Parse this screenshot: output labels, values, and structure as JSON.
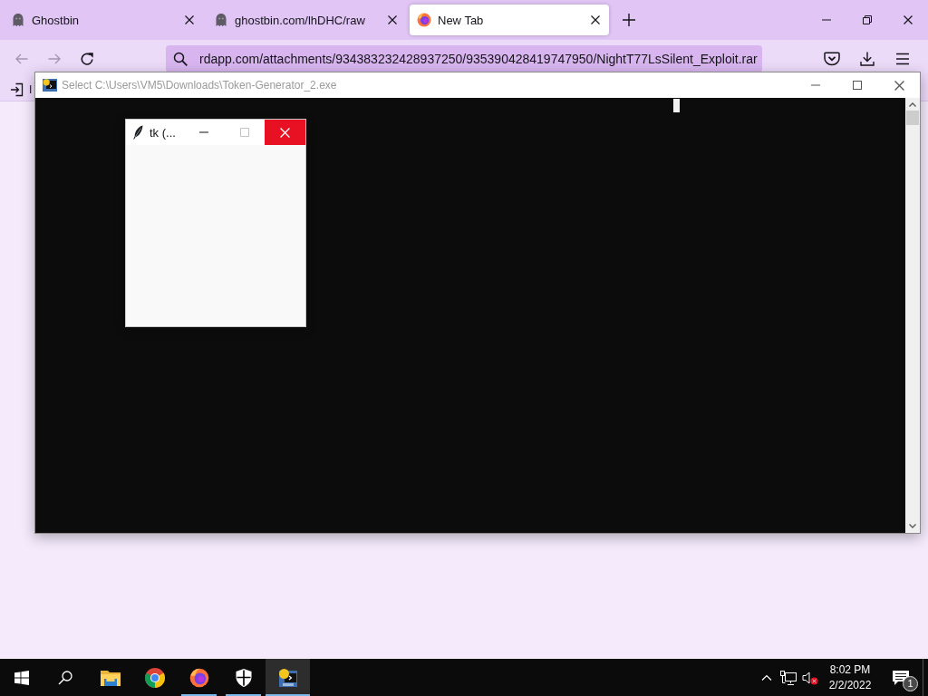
{
  "browser": {
    "tabs": [
      {
        "kind": "ghost",
        "title": "Ghostbin",
        "selected": false
      },
      {
        "kind": "ghost",
        "title": "ghostbin.com/lhDHC/raw",
        "selected": false
      },
      {
        "kind": "firefox",
        "title": "New Tab",
        "selected": true
      }
    ],
    "navigation": {
      "back_disabled": true,
      "forward_disabled": true
    },
    "address_bar": {
      "value": "rdapp.com/attachments/934383232428937250/935390428419747950/NightT77LsSilent_Exploit.rar"
    },
    "bookmarks": [
      {
        "label": "I"
      }
    ]
  },
  "console_window": {
    "title": "Select C:\\Users\\VM5\\Downloads\\Token-Generator_2.exe",
    "active": false,
    "cursor_visible": true
  },
  "tk_window": {
    "title": "tk (...",
    "maximize_disabled": true
  },
  "taskbar": {
    "apps": [
      {
        "kind": "file-explorer",
        "running": false,
        "selected": false
      },
      {
        "kind": "chrome",
        "running": false,
        "selected": false
      },
      {
        "kind": "firefox",
        "running": true,
        "selected": false
      },
      {
        "kind": "security",
        "running": true,
        "selected": false
      },
      {
        "kind": "terminal",
        "running": true,
        "selected": true
      }
    ],
    "volume_muted": true,
    "clock": {
      "time": "8:02 PM",
      "date": "2/2/2022"
    },
    "notification_count": "1"
  }
}
